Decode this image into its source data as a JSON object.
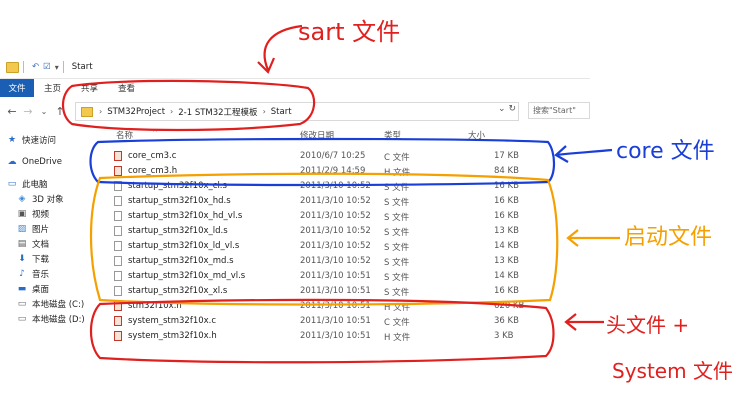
{
  "window": {
    "title": "Start"
  },
  "ribbon": {
    "tabs": [
      "文件",
      "主页",
      "共享",
      "查看"
    ]
  },
  "address": {
    "crumbs": [
      "STM32Project",
      "2-1 STM32工程模板",
      "Start"
    ],
    "search_placeholder": "搜索\"Start\""
  },
  "sidebar": {
    "items": [
      {
        "label": "快速访问",
        "icon": "star-icon"
      },
      {
        "label": "OneDrive",
        "icon": "cloud-icon"
      },
      {
        "label": "此电脑",
        "icon": "computer-icon"
      },
      {
        "label": "3D 对象",
        "icon": "cube-icon"
      },
      {
        "label": "视频",
        "icon": "video-icon"
      },
      {
        "label": "图片",
        "icon": "picture-icon"
      },
      {
        "label": "文档",
        "icon": "document-icon"
      },
      {
        "label": "下载",
        "icon": "download-icon"
      },
      {
        "label": "音乐",
        "icon": "music-icon"
      },
      {
        "label": "桌面",
        "icon": "desktop-icon"
      },
      {
        "label": "本地磁盘 (C:)",
        "icon": "drive-icon"
      },
      {
        "label": "本地磁盘 (D:)",
        "icon": "drive-icon"
      }
    ]
  },
  "columns": {
    "name": "名称",
    "date": "修改日期",
    "type": "类型",
    "size": "大小"
  },
  "files": [
    {
      "name": "core_cm3.c",
      "date": "2010/6/7 10:25",
      "type": "C 文件",
      "size": "17 KB",
      "kind": "c"
    },
    {
      "name": "core_cm3.h",
      "date": "2011/2/9 14:59",
      "type": "H 文件",
      "size": "84 KB",
      "kind": "h"
    },
    {
      "name": "startup_stm32f10x_cl.s",
      "date": "2011/3/10 10:52",
      "type": "S 文件",
      "size": "16 KB",
      "kind": "s"
    },
    {
      "name": "startup_stm32f10x_hd.s",
      "date": "2011/3/10 10:52",
      "type": "S 文件",
      "size": "16 KB",
      "kind": "s"
    },
    {
      "name": "startup_stm32f10x_hd_vl.s",
      "date": "2011/3/10 10:52",
      "type": "S 文件",
      "size": "16 KB",
      "kind": "s"
    },
    {
      "name": "startup_stm32f10x_ld.s",
      "date": "2011/3/10 10:52",
      "type": "S 文件",
      "size": "13 KB",
      "kind": "s"
    },
    {
      "name": "startup_stm32f10x_ld_vl.s",
      "date": "2011/3/10 10:52",
      "type": "S 文件",
      "size": "14 KB",
      "kind": "s"
    },
    {
      "name": "startup_stm32f10x_md.s",
      "date": "2011/3/10 10:52",
      "type": "S 文件",
      "size": "13 KB",
      "kind": "s"
    },
    {
      "name": "startup_stm32f10x_md_vl.s",
      "date": "2011/3/10 10:51",
      "type": "S 文件",
      "size": "14 KB",
      "kind": "s"
    },
    {
      "name": "startup_stm32f10x_xl.s",
      "date": "2011/3/10 10:51",
      "type": "S 文件",
      "size": "16 KB",
      "kind": "s"
    },
    {
      "name": "stm32f10x.h",
      "date": "2011/3/10 10:51",
      "type": "H 文件",
      "size": "620 KB",
      "kind": "h"
    },
    {
      "name": "system_stm32f10x.c",
      "date": "2011/3/10 10:51",
      "type": "C 文件",
      "size": "36 KB",
      "kind": "c"
    },
    {
      "name": "system_stm32f10x.h",
      "date": "2011/3/10 10:51",
      "type": "H 文件",
      "size": "3 KB",
      "kind": "h"
    }
  ],
  "annotations": {
    "top": "sart 文件",
    "core": "core 文件",
    "startup": "启动文件",
    "header_a": "头文件 +",
    "header_b": "System 文件"
  },
  "colors": {
    "red": "#e0201f",
    "blue": "#1a3fd6",
    "orange": "#f5a000",
    "accent": "#1a5fb4"
  }
}
